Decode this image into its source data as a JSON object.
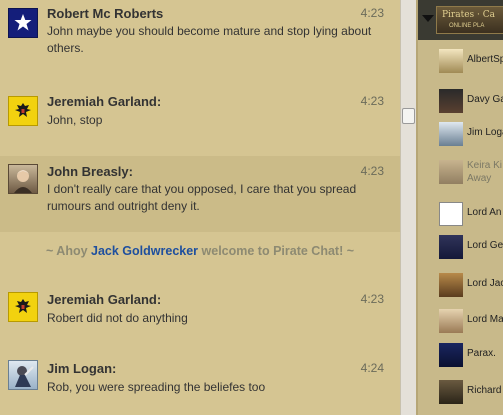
{
  "messages": [
    {
      "name": "Robert Mc Roberts",
      "time": "4:23",
      "text": "John maybe you should become mature and stop lying about others.",
      "avatar": "star-flag"
    },
    {
      "name": "Jeremiah Garland:",
      "time": "4:23",
      "text": "John, stop",
      "avatar": "eagle-flag"
    },
    {
      "name": "John Breasly:",
      "time": "4:23",
      "text": "I don't really care that you opposed, I care that you spread rumours and outright deny it.",
      "avatar": "portrait"
    },
    {
      "name": "Jeremiah Garland:",
      "time": "4:23",
      "text": "Robert did not do anything",
      "avatar": "eagle-flag"
    },
    {
      "name": "Jim Logan:",
      "time": "4:24",
      "text": "Rob, you were spreading the beliefes too",
      "avatar": "pirate"
    }
  ],
  "system": {
    "prefix": "~ Ahoy",
    "user": "Jack Goldwrecker",
    "suffix": "welcome to Pirate Chat! ~"
  },
  "room": {
    "logo_main": "Pirates · Ca",
    "logo_sub": "ONLINE PLA"
  },
  "users": [
    {
      "name": "AlbertSp",
      "status": ""
    },
    {
      "name": "Davy Ga",
      "status": ""
    },
    {
      "name": "Jim Loga",
      "status": ""
    },
    {
      "name": "Keira Ki",
      "status": "Away"
    },
    {
      "name": "Lord An",
      "status": ""
    },
    {
      "name": "Lord Ge",
      "status": ""
    },
    {
      "name": "Lord Jac",
      "status": ""
    },
    {
      "name": "Lord Ma",
      "status": ""
    },
    {
      "name": "Parax.",
      "status": ""
    },
    {
      "name": "Richard",
      "status": ""
    }
  ],
  "colors": {
    "chat_bg": "#d5c592",
    "highlight_bg": "#cbbb88",
    "system_user": "#1e4f9e",
    "system_text": "#8d8a72"
  }
}
